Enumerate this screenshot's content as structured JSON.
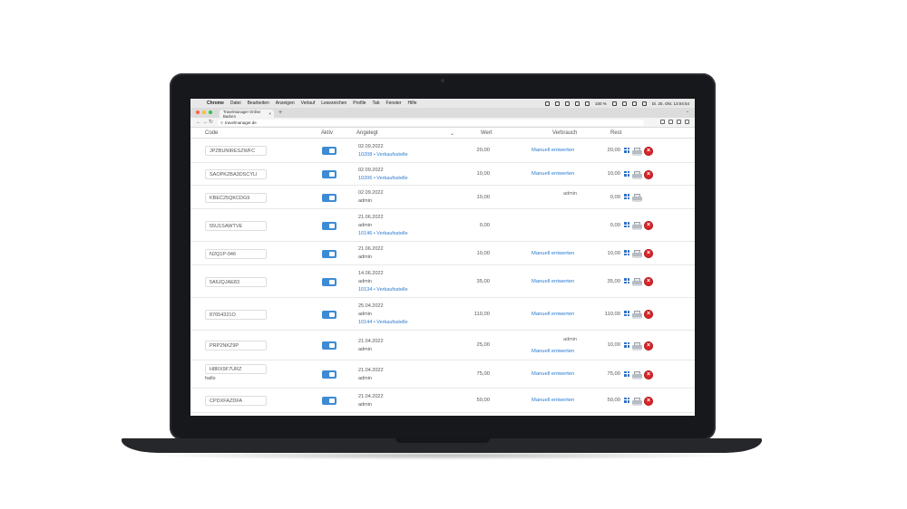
{
  "menubar": {
    "items": [
      "Chrome",
      "Datei",
      "Bearbeiten",
      "Anzeigen",
      "Verlauf",
      "Lesezeichen",
      "Profile",
      "Tab",
      "Fenster",
      "Hilfe"
    ],
    "battery": "100 %",
    "clock": "Di. 25. Okt. 13:04:54"
  },
  "browser": {
    "tab_title": "Travelmanager Online Backen",
    "tab_close": "×",
    "new_tab": "+",
    "url": "travelmanager.de"
  },
  "table": {
    "headers": {
      "code": "Code",
      "aktiv": "Aktiv",
      "angelegt": "Angelegt",
      "sort": "⌄",
      "wert": "Wert",
      "verbrauch": "Verbrauch",
      "rest": "Rest"
    },
    "rows": [
      {
        "code": "JPZBUNIRESZWFC",
        "date": "02.09.2022",
        "line2": "10208 • Verkaufsstelle",
        "wert": "20,00",
        "verbrauch": "Manuell entwerten",
        "rest": "20,00"
      },
      {
        "code": "SAOPKZBA3DSCYLI",
        "date": "02.09.2022",
        "line2": "10206 • Verkaufsstelle",
        "wert": "10,00",
        "verbrauch": "Manuell entwerten",
        "rest": "10,00"
      },
      {
        "code": "KBEC25QKCDG9",
        "date": "02.09.2022",
        "line2": "admin",
        "wert": "10,00",
        "verbrauch_admin": "admin",
        "rest": "0,00"
      },
      {
        "code": "55U1SAWTVE",
        "date": "21.06.2022",
        "line2": "admin",
        "line3": "10146 • Verkaufsstelle",
        "wert": "0,00",
        "rest": "0,00"
      },
      {
        "code": "N2Q1P-046",
        "date": "21.06.2022",
        "line2": "admin",
        "wert": "10,00",
        "verbrauch": "Manuell entwerten",
        "rest": "10,00"
      },
      {
        "code": "5A6JQJAE83",
        "date": "14.06.2022",
        "line2": "admin",
        "line3": "10134 • Verkaufsstelle",
        "wert": "35,00",
        "verbrauch": "Manuell entwerten",
        "rest": "35,00"
      },
      {
        "code": "87654321O",
        "date": "25.04.2022",
        "line2": "admin",
        "line3": "10144 • Verkaufsstelle",
        "wert": "110,00",
        "verbrauch": "Manuell entwerten",
        "rest": "110,00"
      },
      {
        "code": "PRP2NKZ9P",
        "date": "21.04.2022",
        "line2": "admin",
        "wert": "25,00",
        "verbrauch_admin": "admin",
        "verbrauch": "Manuell entwerten",
        "rest": "10,00"
      },
      {
        "code": "H8RX9F7URZ",
        "note": "hallo",
        "date": "21.04.2022",
        "line2": "admin",
        "wert": "75,00",
        "verbrauch": "Manuell entwerten",
        "rest": "75,00"
      },
      {
        "code": "CPDXFAZDFA",
        "date": "21.04.2022",
        "line2": "admin",
        "wert": "50,00",
        "verbrauch": "Manuell entwerten",
        "rest": "50,00"
      }
    ]
  },
  "icons": {
    "delete_symbol": "×",
    "apple": "",
    "lock": "⚲",
    "back": "←",
    "forward": "→",
    "reload": "↻",
    "tab_menu": "⌄"
  },
  "colors": {
    "accent": "#3d8bd4",
    "link": "#2a7bd0",
    "delete": "#d7262a",
    "laptop_frame": "#17181b"
  }
}
